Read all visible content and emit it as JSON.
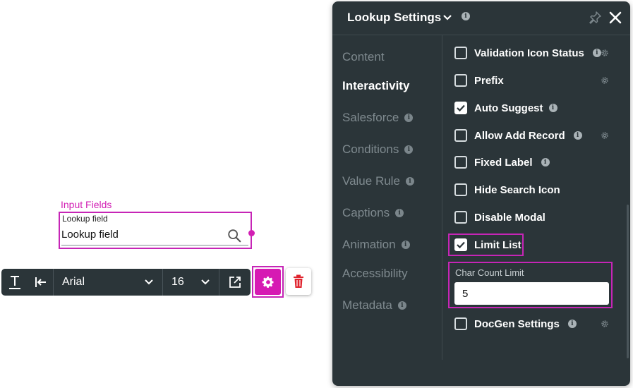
{
  "canvas": {
    "group_label": "Input Fields",
    "field_label": "Lookup field",
    "field_value": "Lookup field"
  },
  "toolbar": {
    "font": "Arial",
    "size": "16"
  },
  "panel": {
    "title": "Lookup Settings",
    "nav": [
      {
        "label": "Content",
        "active": false,
        "info": false
      },
      {
        "label": "Interactivity",
        "active": true,
        "info": false
      },
      {
        "label": "Salesforce",
        "active": false,
        "info": true
      },
      {
        "label": "Conditions",
        "active": false,
        "info": true
      },
      {
        "label": "Value Rule",
        "active": false,
        "info": true
      },
      {
        "label": "Captions",
        "active": false,
        "info": true
      },
      {
        "label": "Animation",
        "active": false,
        "info": true
      },
      {
        "label": "Accessibility",
        "active": false,
        "info": false
      },
      {
        "label": "Metadata",
        "active": false,
        "info": true
      }
    ],
    "options": [
      {
        "label": "Validation Icon Status",
        "checked": false,
        "info": true,
        "settings": true
      },
      {
        "label": "Prefix",
        "checked": false,
        "info": false,
        "settings": true
      },
      {
        "label": "Auto Suggest",
        "checked": true,
        "info": true,
        "settings": false
      },
      {
        "label": "Allow Add Record",
        "checked": false,
        "info": true,
        "settings": true
      },
      {
        "label": "Fixed Label",
        "checked": false,
        "info": true,
        "settings": false
      },
      {
        "label": "Hide Search Icon",
        "checked": false,
        "info": false,
        "settings": false
      },
      {
        "label": "Disable Modal",
        "checked": false,
        "info": false,
        "settings": false
      },
      {
        "label": "Limit List",
        "checked": true,
        "info": false,
        "settings": false
      },
      {
        "label": "DocGen Settings",
        "checked": false,
        "info": true,
        "settings": true
      }
    ],
    "char_count": {
      "label": "Char Count Limit",
      "value": "5"
    }
  },
  "colors": {
    "accent": "#d61ab3",
    "panel_bg": "#2b3539",
    "highlight": "#c625b6"
  }
}
